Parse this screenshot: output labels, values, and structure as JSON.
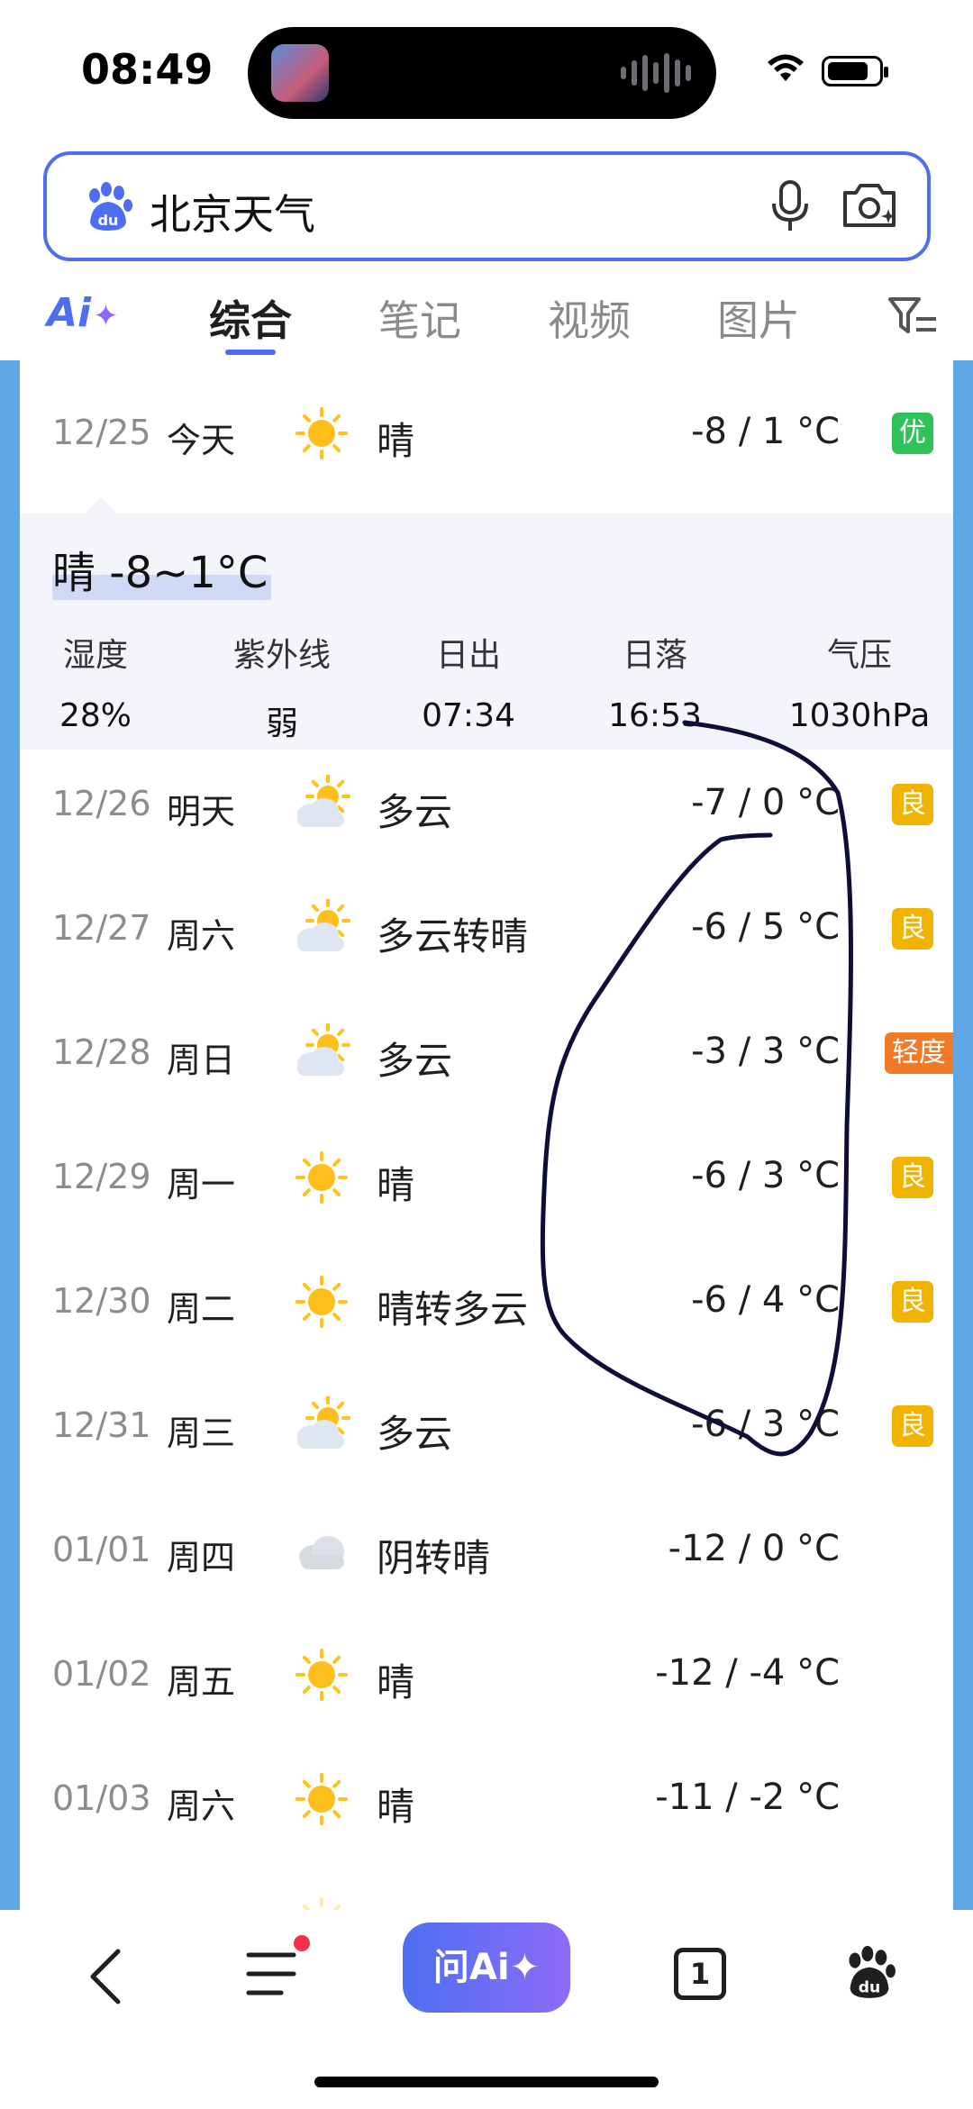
{
  "status_bar": {
    "time": "08:49"
  },
  "search": {
    "query": "北京天气"
  },
  "tabs": {
    "ai_label": "Ai",
    "items": [
      "综合",
      "笔记",
      "视频",
      "图片"
    ]
  },
  "today": {
    "date": "12/25",
    "day": "今天",
    "condition": "晴",
    "icon": "sun-icon",
    "temp": "-8 / 1 °C",
    "aqi": "优"
  },
  "detail": {
    "headline": "晴 -8~1°C",
    "stats": [
      {
        "label": "湿度",
        "value": "28%"
      },
      {
        "label": "紫外线",
        "value": "弱"
      },
      {
        "label": "日出",
        "value": "07:34"
      },
      {
        "label": "日落",
        "value": "16:53"
      },
      {
        "label": "气压",
        "value": "1030hPa"
      }
    ]
  },
  "forecast": [
    {
      "date": "12/26",
      "day": "明天",
      "condition": "多云",
      "icon": "cloud-sun-icon",
      "temp": "-7 / 0 °C",
      "aqi": "良"
    },
    {
      "date": "12/27",
      "day": "周六",
      "condition": "多云转晴",
      "icon": "cloud-sun-icon",
      "temp": "-6 / 5 °C",
      "aqi": "良"
    },
    {
      "date": "12/28",
      "day": "周日",
      "condition": "多云",
      "icon": "cloud-sun-icon",
      "temp": "-3 / 3 °C",
      "aqi": "轻度"
    },
    {
      "date": "12/29",
      "day": "周一",
      "condition": "晴",
      "icon": "sun-icon",
      "temp": "-6 / 3 °C",
      "aqi": "良"
    },
    {
      "date": "12/30",
      "day": "周二",
      "condition": "晴转多云",
      "icon": "sun-icon",
      "temp": "-6 / 4 °C",
      "aqi": "良"
    },
    {
      "date": "12/31",
      "day": "周三",
      "condition": "多云",
      "icon": "cloud-sun-icon",
      "temp": "-6 / 3 °C",
      "aqi": "良"
    },
    {
      "date": "01/01",
      "day": "周四",
      "condition": "阴转晴",
      "icon": "cloud-icon",
      "temp": "-12 / 0 °C",
      "aqi": ""
    },
    {
      "date": "01/02",
      "day": "周五",
      "condition": "晴",
      "icon": "sun-icon",
      "temp": "-12 / -4 °C",
      "aqi": ""
    },
    {
      "date": "01/03",
      "day": "周六",
      "condition": "晴",
      "icon": "sun-icon",
      "temp": "-11 / -2 °C",
      "aqi": ""
    }
  ],
  "bottom_nav": {
    "ai_button": "问Ai✦",
    "tab_count": "1"
  },
  "colors": {
    "accent": "#4e6ef2",
    "aqi_good": "#f0b400",
    "aqi_excellent": "#2fc257",
    "aqi_light": "#f07a28",
    "side_bg": "#5ea7e5",
    "annotation": "#0d0f3a"
  }
}
